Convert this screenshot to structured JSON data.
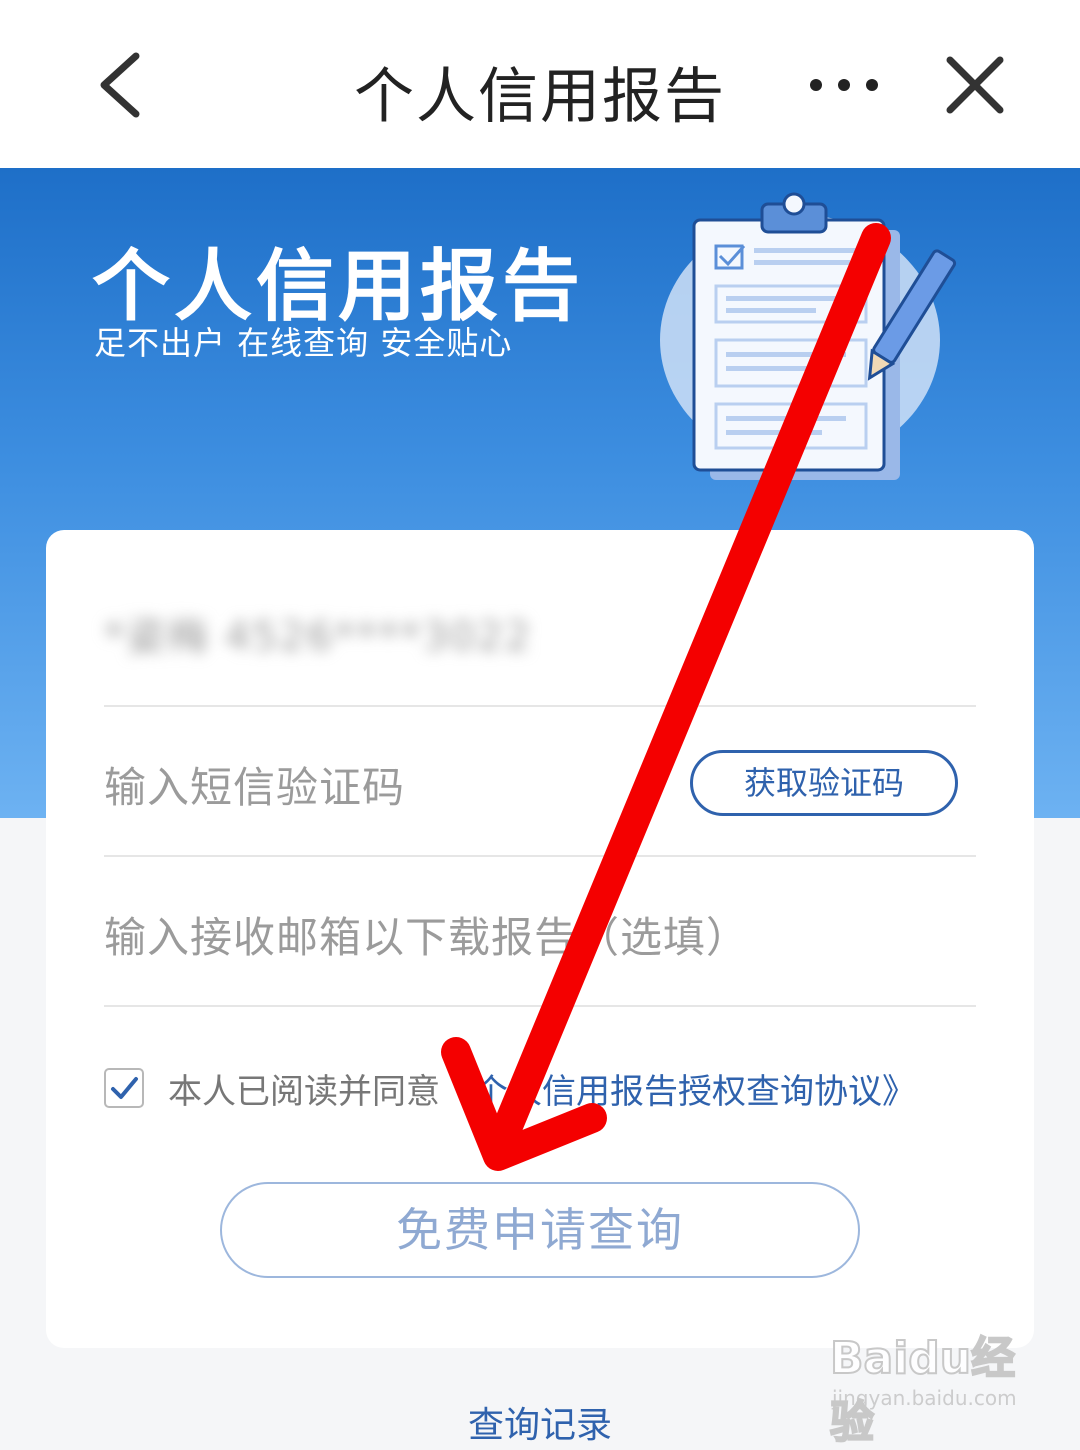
{
  "nav": {
    "title": "个人信用报告",
    "back_icon": "chevron-left-icon",
    "more_icon": "more-dots-icon",
    "close_icon": "close-icon"
  },
  "hero": {
    "title": "个人信用报告",
    "subtitle": "足不出户 在线查询 安全贴心",
    "illustration": "clipboard-report-illustration"
  },
  "form": {
    "masked_identity": "*姿梅 4526****3022",
    "sms_placeholder": "输入短信验证码",
    "get_code_label": "获取验证码",
    "email_placeholder": "输入接收邮箱以下载报告（选填）",
    "agree_checked": true,
    "agree_prefix": "本人已阅读并同意",
    "agree_link": "《个人信用报告授权查询协议》",
    "submit_label": "免费申请查询"
  },
  "footer": {
    "records_link": "查询记录"
  },
  "watermark": {
    "logo": "Baidu经验",
    "url": "jingyan.baidu.com"
  },
  "colors": {
    "accent": "#2f62ad",
    "hero_top": "#1e6fc8",
    "hero_bottom": "#6db2f2",
    "annotation_arrow": "#ff0000"
  }
}
